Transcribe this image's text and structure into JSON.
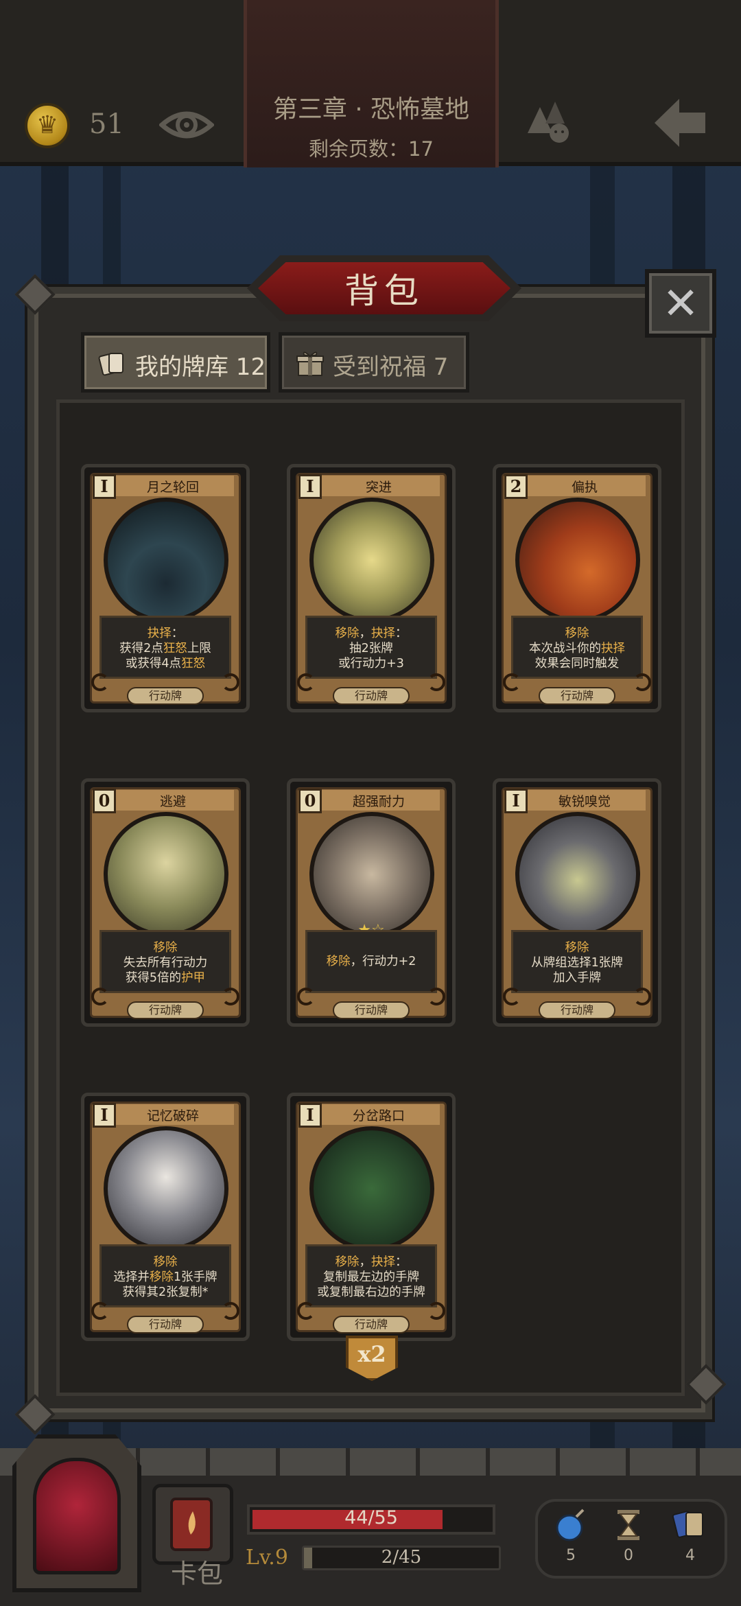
{
  "topbar": {
    "coins": "51",
    "chapter_title": "第三章 · 恐怖墓地",
    "pages_left": "剩余页数：17"
  },
  "bag": {
    "title": "背包",
    "close_label": "✕",
    "tabs": [
      {
        "label": "我的牌库 12",
        "active": true
      },
      {
        "label": "受到祝福 7",
        "active": false
      }
    ]
  },
  "cards": [
    {
      "cost": "I",
      "name": "月之轮回",
      "desc": [
        "抉择：",
        "获得2点狂怒上限",
        "或获得4点狂怒"
      ],
      "type": "行动牌",
      "art": "moon-phases"
    },
    {
      "cost": "I",
      "name": "突进",
      "desc": [
        "移除，抉择：",
        "抽2张牌",
        "或行动力+3"
      ],
      "type": "行动牌",
      "art": "werewolf-leap"
    },
    {
      "cost": "2",
      "name": "偏执",
      "desc": [
        "移除",
        "本次战斗你的抉择",
        "效果会同时触发"
      ],
      "type": "行动牌",
      "art": "wolf-bear"
    },
    {
      "cost": "0",
      "name": "逃避",
      "desc": [
        "移除",
        "失去所有行动力",
        "获得5倍的护甲"
      ],
      "type": "行动牌",
      "art": "bear-boy"
    },
    {
      "cost": "0",
      "name": "超强耐力",
      "desc": [
        "移除，行动力+2"
      ],
      "type": "行动牌",
      "art": "boy-axe",
      "stars": "★☆"
    },
    {
      "cost": "I",
      "name": "敏锐嗅觉",
      "desc": [
        "移除",
        "从牌组选择1张牌",
        "加入手牌"
      ],
      "type": "行动牌",
      "art": "wolf-snarl"
    },
    {
      "cost": "I",
      "name": "记忆破碎",
      "desc": [
        "移除",
        "选择并移除1张手牌",
        "获得其2张复制*"
      ],
      "type": "行动牌",
      "art": "memory-shatter"
    },
    {
      "cost": "I",
      "name": "分岔路口",
      "desc": [
        "移除，抉择：",
        "复制最左边的手牌",
        "或复制最右边的手牌"
      ],
      "type": "行动牌",
      "art": "forest-path",
      "badge": "x2"
    }
  ],
  "bottom": {
    "deck_label": "卡包",
    "hp": "44/55",
    "hp_fraction": 0.8,
    "level": "Lv.9",
    "xp": "2/45",
    "xp_fraction": 0.044,
    "resources": [
      {
        "icon": "bomb-icon",
        "count": "5"
      },
      {
        "icon": "hourglass-icon",
        "count": "0"
      },
      {
        "icon": "cards-icon",
        "count": "4"
      }
    ]
  },
  "colors": {
    "accent_red": "#8a1c1a",
    "highlight": "#e8b04a",
    "gold": "#b48a3a"
  }
}
